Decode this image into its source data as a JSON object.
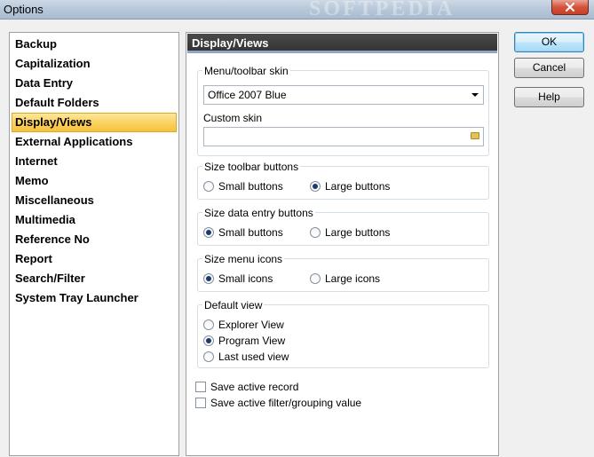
{
  "window": {
    "title": "Options",
    "watermark": "SOFTPEDIA"
  },
  "sidebar": {
    "items": [
      {
        "label": "Backup"
      },
      {
        "label": "Capitalization"
      },
      {
        "label": "Data Entry"
      },
      {
        "label": "Default Folders"
      },
      {
        "label": "Display/Views",
        "selected": true
      },
      {
        "label": "External Applications"
      },
      {
        "label": "Internet"
      },
      {
        "label": "Memo"
      },
      {
        "label": "Miscellaneous"
      },
      {
        "label": "Multimedia"
      },
      {
        "label": "Reference No"
      },
      {
        "label": "Report"
      },
      {
        "label": "Search/Filter"
      },
      {
        "label": "System Tray Launcher"
      }
    ]
  },
  "panel": {
    "header": "Display/Views",
    "skin_group": {
      "label": "Menu/toolbar skin",
      "selected_skin": "Office 2007 Blue",
      "custom_skin_label": "Custom skin",
      "custom_skin_value": ""
    },
    "toolbar_buttons": {
      "label": "Size toolbar buttons",
      "options": [
        "Small buttons",
        "Large buttons"
      ],
      "selected": "Large buttons"
    },
    "data_entry_buttons": {
      "label": "Size data entry buttons",
      "options": [
        "Small buttons",
        "Large buttons"
      ],
      "selected": "Small buttons"
    },
    "menu_icons": {
      "label": "Size menu icons",
      "options": [
        "Small icons",
        "Large icons"
      ],
      "selected": "Small icons"
    },
    "default_view": {
      "label": "Default view",
      "options": [
        "Explorer View",
        "Program View",
        "Last used view"
      ],
      "selected": "Program View"
    },
    "checkboxes": {
      "save_active_record": "Save active record",
      "save_active_record_checked": false,
      "save_filter": "Save active filter/grouping value",
      "save_filter_checked": false
    }
  },
  "buttons": {
    "ok": "OK",
    "cancel": "Cancel",
    "help": "Help"
  },
  "colors": {
    "selection": "#fbd264",
    "header_bg": "#3c3c3c",
    "header_accent": "#8fa7c4",
    "close_button": "#d5533a"
  }
}
